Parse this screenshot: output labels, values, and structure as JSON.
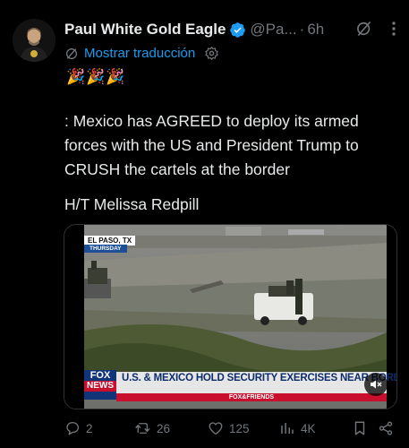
{
  "tweet": {
    "author_name": "Paul White Gold Eagle",
    "handle": "@Pa...",
    "separator": "·",
    "time": "6h",
    "translate_label": "Mostrar traducción",
    "emoji": "🎉🎉🎉",
    "body": ": Mexico has AGREED to deploy its armed forces with the US and President Trump to CRUSH the cartels at the border",
    "hat_tip": "H/T Melissa Redpill"
  },
  "media": {
    "location_tag": "EL PASO, TX",
    "day_tag": "THURSDAY",
    "fox_logo_top": "FOX",
    "fox_logo_bottom": "NEWS",
    "headline": "U.S. & MEXICO HOLD SECURITY EXERCISES NEAR BORDE",
    "show_name": "FOX&FRIENDS"
  },
  "actions": {
    "replies": "2",
    "reposts": "26",
    "likes": "125",
    "views": "4K"
  },
  "colors": {
    "background": "#000000",
    "text": "#e7e9ea",
    "muted": "#71767b",
    "accent": "#1d9bf0",
    "repost_green": "#00ba7c"
  }
}
